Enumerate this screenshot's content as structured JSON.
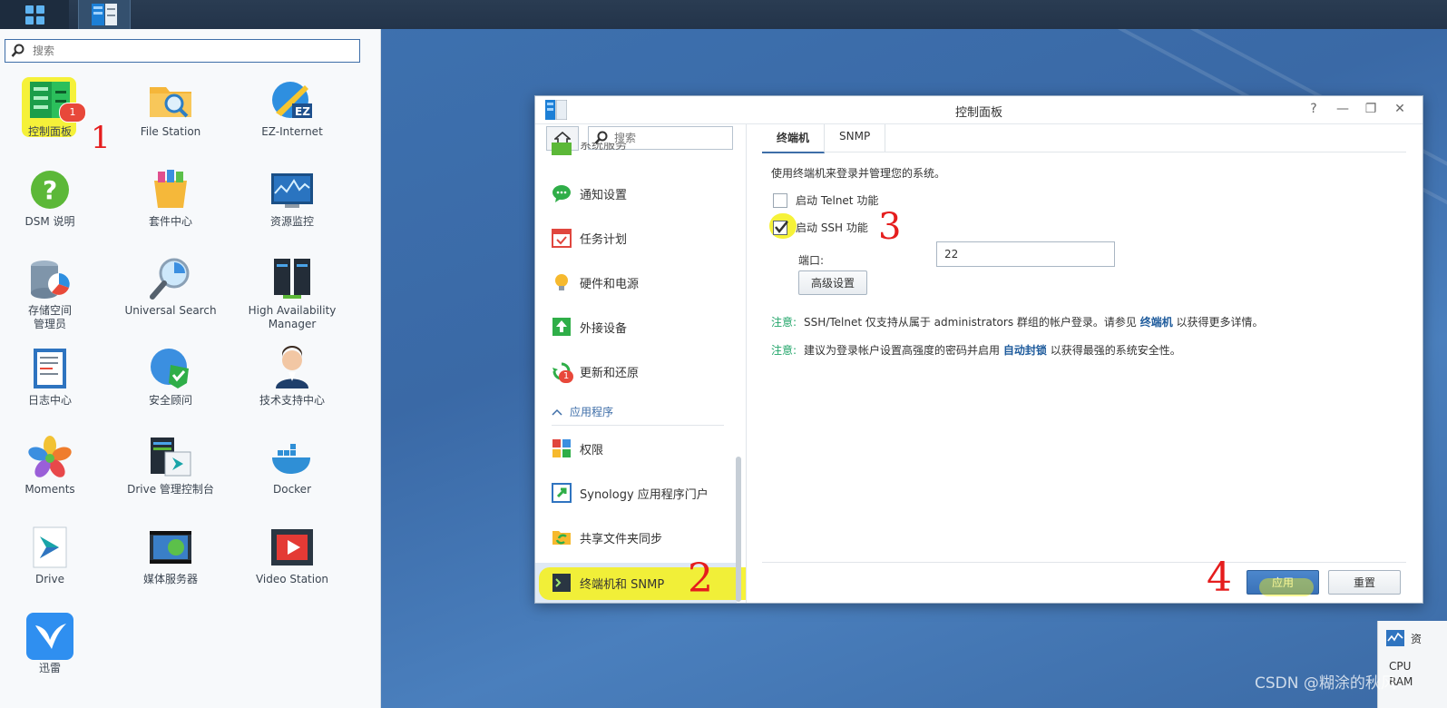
{
  "taskbar": {
    "main_menu_icon": "grid-icon",
    "open_app_icon": "control-panel-icon"
  },
  "menu": {
    "search_placeholder": "搜索",
    "apps": [
      {
        "label": "控制面板",
        "icon": "control-panel-icon",
        "badge": "1"
      },
      {
        "label": "File Station",
        "icon": "folder-icon"
      },
      {
        "label": "EZ-Internet",
        "icon": "ez-internet-icon"
      },
      {
        "label": "DSM 说明",
        "icon": "help-icon"
      },
      {
        "label": "套件中心",
        "icon": "package-center-icon"
      },
      {
        "label": "资源监控",
        "icon": "resource-monitor-icon"
      },
      {
        "label": "存储空间\n管理员",
        "icon": "storage-manager-icon"
      },
      {
        "label": "Universal Search",
        "icon": "universal-search-icon"
      },
      {
        "label": "High Availability\nManager",
        "icon": "high-availability-icon"
      },
      {
        "label": "日志中心",
        "icon": "log-center-icon"
      },
      {
        "label": "安全顾问",
        "icon": "security-advisor-icon"
      },
      {
        "label": "技术支持中心",
        "icon": "support-center-icon"
      },
      {
        "label": "Moments",
        "icon": "moments-icon"
      },
      {
        "label": "Drive 管理控制台",
        "icon": "drive-admin-icon"
      },
      {
        "label": "Docker",
        "icon": "docker-icon"
      },
      {
        "label": "Drive",
        "icon": "drive-icon"
      },
      {
        "label": "媒体服务器",
        "icon": "media-server-icon"
      },
      {
        "label": "Video Station",
        "icon": "video-station-icon"
      },
      {
        "label": "迅雷",
        "icon": "xunlei-icon"
      }
    ]
  },
  "window": {
    "title": "控制面板",
    "controls": [
      "?",
      "—",
      "❐",
      "✕"
    ],
    "search_placeholder": "搜索",
    "sidebar": {
      "cut_item": "系统服务",
      "items": [
        {
          "label": "通知设置",
          "icon": "notification-icon"
        },
        {
          "label": "任务计划",
          "icon": "task-scheduler-icon"
        },
        {
          "label": "硬件和电源",
          "icon": "hardware-power-icon"
        },
        {
          "label": "外接设备",
          "icon": "external-devices-icon"
        },
        {
          "label": "更新和还原",
          "icon": "update-restore-icon",
          "badge": "1"
        }
      ],
      "section": "应用程序",
      "app_items": [
        {
          "label": "权限",
          "icon": "privileges-icon"
        },
        {
          "label": "Synology 应用程序门户",
          "icon": "app-portal-icon"
        },
        {
          "label": "共享文件夹同步",
          "icon": "shared-folder-sync-icon"
        },
        {
          "label": "终端机和 SNMP",
          "icon": "terminal-icon"
        }
      ]
    },
    "tabs": [
      "终端机",
      "SNMP"
    ],
    "description": "使用终端机来登录并管理您的系统。",
    "telnet_label": "启动 Telnet 功能",
    "telnet_checked": false,
    "ssh_label": "启动 SSH 功能",
    "ssh_checked": true,
    "port_label": "端口:",
    "port_value": "22",
    "advanced_button": "高级设置",
    "notes": [
      {
        "key": "注意:",
        "pre": "SSH/Telnet 仅支持从属于 administrators 群组的帐户登录。请参见 ",
        "link": "终端机",
        "post": " 以获得更多详情。"
      },
      {
        "key": "注意:",
        "pre": "建议为登录帐户设置高强度的密码并启用 ",
        "link": "自动封锁",
        "post": " 以获得最强的系统安全性。"
      }
    ],
    "apply_button": "应用",
    "reset_button": "重置"
  },
  "widget": {
    "title": "资",
    "rows": [
      "CPU",
      "RAM"
    ]
  },
  "annotations": [
    "1",
    "2",
    "3",
    "4"
  ],
  "watermark": "CSDN @糊涂的秋风"
}
